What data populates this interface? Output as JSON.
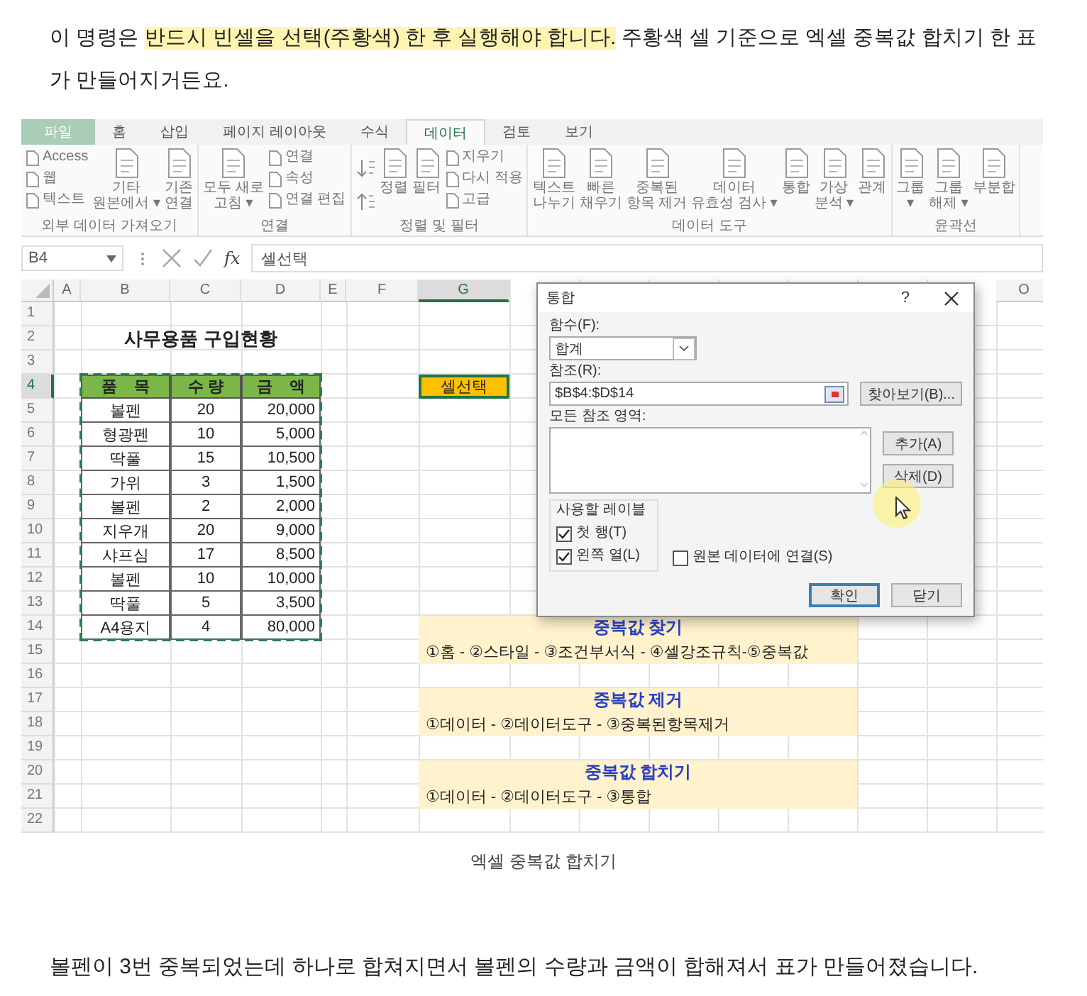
{
  "article_intro": [
    {
      "text": "이 명령은 ",
      "highlight": false
    },
    {
      "text": "반드시 빈셀을 선택(주황색) 한 후 실행해야 합니다.",
      "highlight": true
    },
    {
      "text": " 주황색 셀 기준으로 엑셀 중복값 합치기 한 표가 만들어지거든요.",
      "highlight": false
    }
  ],
  "screenshot": {
    "ribbon": {
      "tabs": [
        {
          "label": "파일",
          "selected": false,
          "kind": "file"
        },
        {
          "label": "홈",
          "selected": false,
          "kind": "tab"
        },
        {
          "label": "삽입",
          "selected": false,
          "kind": "tab"
        },
        {
          "label": "페이지 레이아웃",
          "selected": false,
          "kind": "tab"
        },
        {
          "label": "수식",
          "selected": false,
          "kind": "tab"
        },
        {
          "label": "데이터",
          "selected": true,
          "kind": "tab"
        },
        {
          "label": "검토",
          "selected": false,
          "kind": "tab"
        },
        {
          "label": "보기",
          "selected": false,
          "kind": "tab"
        }
      ],
      "groups": [
        {
          "label": "외부 데이터 가져오기",
          "items": [
            {
              "kind": "stack",
              "entries": [
                "Access",
                "웹",
                "텍스트"
              ]
            },
            {
              "kind": "large",
              "lines": [
                "기타",
                "원본에서 ▾"
              ]
            },
            {
              "kind": "large",
              "lines": [
                "기존",
                "연결"
              ]
            }
          ]
        },
        {
          "label": "연결",
          "items": [
            {
              "kind": "large",
              "lines": [
                "모두 새로",
                "고침 ▾"
              ]
            },
            {
              "kind": "stack",
              "entries": [
                "연결",
                "속성",
                "연결 편집"
              ]
            }
          ]
        },
        {
          "label": "정렬 및 필터",
          "items": [
            {
              "kind": "sort"
            },
            {
              "kind": "large",
              "lines": [
                "정렬"
              ]
            },
            {
              "kind": "large",
              "lines": [
                "필터"
              ]
            },
            {
              "kind": "stack",
              "entries": [
                "지우기",
                "다시 적용",
                "고급"
              ]
            }
          ]
        },
        {
          "label": "데이터 도구",
          "items": [
            {
              "kind": "large",
              "lines": [
                "텍스트",
                "나누기"
              ]
            },
            {
              "kind": "large",
              "lines": [
                "빠른",
                "채우기"
              ]
            },
            {
              "kind": "large",
              "lines": [
                "중복된",
                "항목 제거"
              ]
            },
            {
              "kind": "large",
              "lines": [
                "데이터",
                "유효성 검사 ▾"
              ]
            },
            {
              "kind": "large",
              "lines": [
                "통합"
              ]
            },
            {
              "kind": "large",
              "lines": [
                "가상",
                "분석 ▾"
              ]
            },
            {
              "kind": "large",
              "lines": [
                "관계"
              ]
            }
          ]
        },
        {
          "label": "윤곽선",
          "items": [
            {
              "kind": "large",
              "lines": [
                "그룹",
                "▾"
              ]
            },
            {
              "kind": "large",
              "lines": [
                "그룹",
                "해제 ▾"
              ]
            },
            {
              "kind": "large",
              "lines": [
                "부분합"
              ]
            }
          ]
        }
      ]
    },
    "formula_bar": {
      "name_box": "B4",
      "fx": "fx",
      "value": "셀선택"
    },
    "sheet": {
      "columns": [
        {
          "label": "A",
          "selected": false
        },
        {
          "label": "B",
          "selected": false
        },
        {
          "label": "C",
          "selected": false
        },
        {
          "label": "D",
          "selected": false
        },
        {
          "label": "E",
          "selected": false
        },
        {
          "label": "F",
          "selected": false
        },
        {
          "label": "G",
          "selected": true
        },
        {
          "label": "O",
          "selected": false
        }
      ],
      "rows": [
        {
          "label": "1",
          "selected": false
        },
        {
          "label": "2",
          "selected": false
        },
        {
          "label": "3",
          "selected": false
        },
        {
          "label": "4",
          "selected": true
        },
        {
          "label": "5",
          "selected": false
        },
        {
          "label": "6",
          "selected": false
        },
        {
          "label": "7",
          "selected": false
        },
        {
          "label": "8",
          "selected": false
        },
        {
          "label": "9",
          "selected": false
        },
        {
          "label": "10",
          "selected": false
        },
        {
          "label": "11",
          "selected": false
        },
        {
          "label": "12",
          "selected": false
        },
        {
          "label": "13",
          "selected": false
        },
        {
          "label": "14",
          "selected": false
        },
        {
          "label": "15",
          "selected": false
        },
        {
          "label": "16",
          "selected": false
        },
        {
          "label": "17",
          "selected": false
        },
        {
          "label": "18",
          "selected": false
        },
        {
          "label": "19",
          "selected": false
        },
        {
          "label": "20",
          "selected": false
        },
        {
          "label": "21",
          "selected": false
        },
        {
          "label": "22",
          "selected": false
        }
      ],
      "title": "사무용품 구입현황",
      "table": {
        "header": [
          "품    목",
          "수 량",
          "금    액"
        ],
        "rows": [
          [
            "볼펜",
            "20",
            "20,000"
          ],
          [
            "형광펜",
            "10",
            "5,000"
          ],
          [
            "딱풀",
            "15",
            "10,500"
          ],
          [
            "가위",
            "3",
            "1,500"
          ],
          [
            "볼펜",
            "2",
            "2,000"
          ],
          [
            "지우개",
            "20",
            "9,000"
          ],
          [
            "샤프심",
            "17",
            "8,500"
          ],
          [
            "볼펜",
            "10",
            "10,000"
          ],
          [
            "딱풀",
            "5",
            "3,500"
          ],
          [
            "A4용지",
            "4",
            "80,000"
          ]
        ]
      },
      "selected_cell": "셀선택",
      "notes": [
        {
          "title": "중복값 찾기",
          "steps": "①홈 - ②스타일 - ③조건부서식 - ④셀강조규칙-⑤중복값"
        },
        {
          "title": "중복값 제거",
          "steps": "①데이터 - ②데이터도구 - ③중복된항목제거"
        },
        {
          "title": "중복값 합치기",
          "steps": "①데이터 - ②데이터도구 - ③통합"
        }
      ]
    },
    "dialog": {
      "title": "통합",
      "help": "?",
      "function_label": "함수(F):",
      "function_value": "합계",
      "reference_label": "참조(R):",
      "reference_value": "$B$4:$D$14",
      "browse_button": "찾아보기(B)...",
      "all_references_label": "모든 참조 영역:",
      "side_buttons": [
        "추가(A)",
        "삭제(D)"
      ],
      "labels_group": {
        "title": "사용할 레이블",
        "checkboxes": [
          {
            "label": "첫 행(T)",
            "checked": true
          },
          {
            "label": "왼쪽 열(L)",
            "checked": true
          }
        ]
      },
      "link_checkbox": {
        "label": "원본 데이터에 연결(S)",
        "checked": false
      },
      "buttons": [
        {
          "label": "확인",
          "default": true
        },
        {
          "label": "닫기",
          "default": false
        }
      ]
    }
  },
  "caption": "엑셀 중복값 합치기",
  "article_body": "볼펜이 3번 중복되었는데 하나로 합쳐지면서 볼펜의 수량과 금액이 합해져서 표가 만들어졌습니다."
}
